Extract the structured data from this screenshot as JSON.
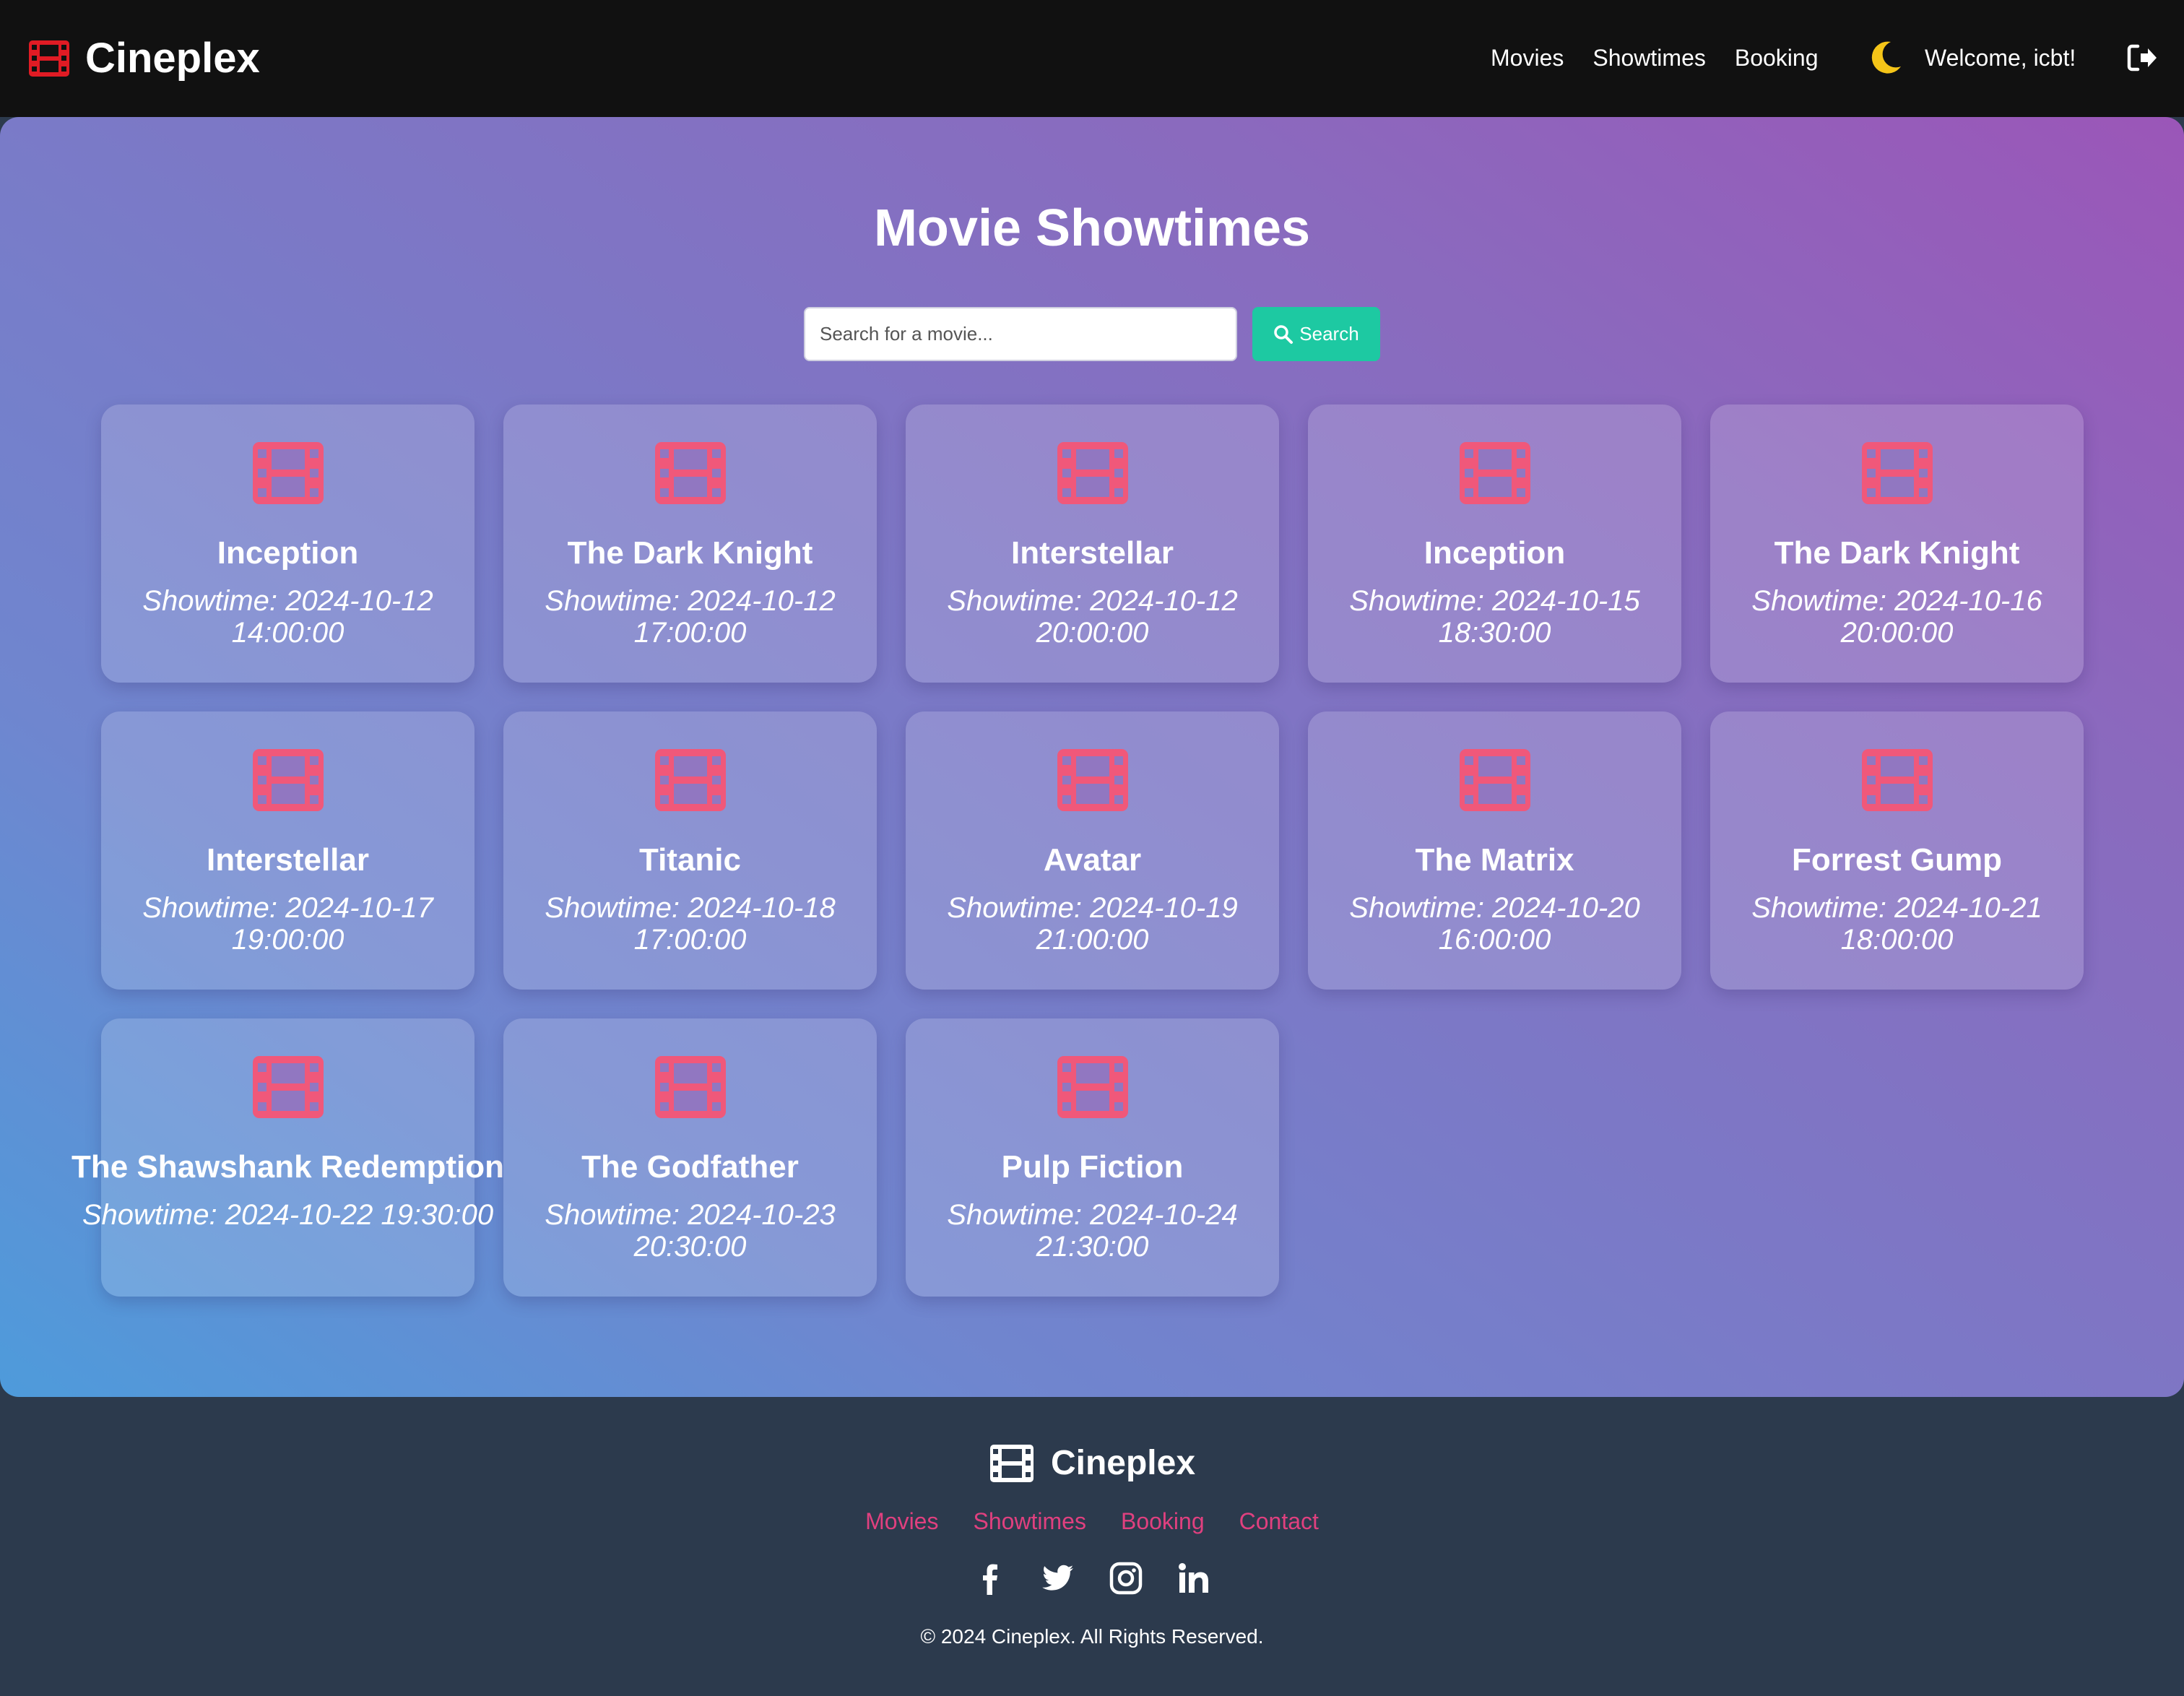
{
  "header": {
    "brand": "Cineplex",
    "nav": [
      "Movies",
      "Showtimes",
      "Booking"
    ],
    "welcome": "Welcome, icbt!",
    "icons": {
      "brand": "film-icon",
      "theme": "moon-icon",
      "logout": "logout-icon"
    }
  },
  "main": {
    "title": "Movie Showtimes",
    "search": {
      "placeholder": "Search for a movie...",
      "button_label": "Search"
    },
    "movies": [
      {
        "title": "Inception",
        "showtime": "Showtime: 2024-10-12 14:00:00"
      },
      {
        "title": "The Dark Knight",
        "showtime": "Showtime: 2024-10-12 17:00:00"
      },
      {
        "title": "Interstellar",
        "showtime": "Showtime: 2024-10-12 20:00:00"
      },
      {
        "title": "Inception",
        "showtime": "Showtime: 2024-10-15 18:30:00"
      },
      {
        "title": "The Dark Knight",
        "showtime": "Showtime: 2024-10-16 20:00:00"
      },
      {
        "title": "Interstellar",
        "showtime": "Showtime: 2024-10-17 19:00:00"
      },
      {
        "title": "Titanic",
        "showtime": "Showtime: 2024-10-18 17:00:00"
      },
      {
        "title": "Avatar",
        "showtime": "Showtime: 2024-10-19 21:00:00"
      },
      {
        "title": "The Matrix",
        "showtime": "Showtime: 2024-10-20 16:00:00"
      },
      {
        "title": "Forrest Gump",
        "showtime": "Showtime: 2024-10-21 18:00:00"
      },
      {
        "title": "The Shawshank Redemption",
        "showtime": "Showtime: 2024-10-22 19:30:00"
      },
      {
        "title": "The Godfather",
        "showtime": "Showtime: 2024-10-23 20:30:00"
      },
      {
        "title": "Pulp Fiction",
        "showtime": "Showtime: 2024-10-24 21:30:00"
      }
    ]
  },
  "footer": {
    "brand": "Cineplex",
    "links": [
      "Movies",
      "Showtimes",
      "Booking",
      "Contact"
    ],
    "social": [
      "facebook-icon",
      "twitter-icon",
      "instagram-icon",
      "linkedin-icon"
    ],
    "copyright": "© 2024 Cineplex. All Rights Reserved."
  },
  "colors": {
    "header_bg": "#111111",
    "brand_red": "#e01b24",
    "film_icon_pink": "#f0587a",
    "search_button": "#1dc9a2",
    "footer_bg": "#2c3a4d",
    "footer_link": "#e0407f"
  }
}
